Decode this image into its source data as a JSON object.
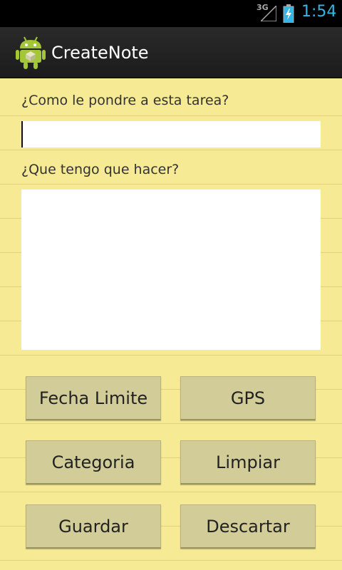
{
  "status_bar": {
    "network": "3G",
    "time": "1:54",
    "signal_icon": "signal-icon",
    "battery_icon": "battery-charging-icon",
    "clock_color": "#33b5e5"
  },
  "action_bar": {
    "icon": "android-app-icon",
    "title": "CreateNote"
  },
  "form": {
    "title_label": "¿Como le pondre a esta tarea?",
    "title_value": "",
    "desc_label": "¿Que tengo que hacer?",
    "desc_value": ""
  },
  "buttons": {
    "fecha_limite": "Fecha Limite",
    "gps": "GPS",
    "categoria": "Categoria",
    "limpiar": "Limpiar",
    "guardar": "Guardar",
    "descartar": "Descartar"
  },
  "colors": {
    "background": "#f7ea94",
    "button": "#d1cc98"
  }
}
